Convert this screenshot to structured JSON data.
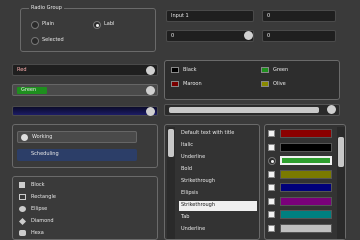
{
  "radio_group": {
    "title": "Radio Group",
    "options": [
      {
        "label": "Plain",
        "selected": false
      },
      {
        "label": "Labl",
        "selected": true
      },
      {
        "label": "Selected",
        "selected": false
      }
    ]
  },
  "inputs": {
    "text_value": "Input 1",
    "slider_value": "0",
    "top_right_value": "0",
    "mid_right_value": "0"
  },
  "labels": {
    "red_label": "Red",
    "green_label": "Green"
  },
  "colors": {
    "swatch_items": [
      {
        "label": "Black",
        "color": "#000000"
      },
      {
        "label": "Green",
        "color": "#1e8f1e"
      },
      {
        "label": "Maroon",
        "color": "#7a0000"
      },
      {
        "label": "Olive",
        "color": "#8a8a00"
      }
    ]
  },
  "toggle_list": {
    "items": [
      "Working",
      "Scheduling"
    ]
  },
  "shapes_list": {
    "items": [
      "Block",
      "Rectangle",
      "Ellipse",
      "Diamond",
      "Hexa"
    ]
  },
  "text_list": {
    "items": [
      "Default text with title",
      "Italic",
      "Underline",
      "Bold",
      "Strikethrough",
      "Ellipsis",
      "Strikethrough",
      "Tab",
      "Underline"
    ],
    "selected_index": 6
  },
  "color_list": {
    "items": [
      {
        "color": "#8b0000",
        "checked": false
      },
      {
        "color": "#000000",
        "checked": false
      },
      {
        "color": "#2e9e2e",
        "checked": true,
        "radio": true
      },
      {
        "color": "#7a7a00",
        "checked": false
      },
      {
        "color": "#00007a",
        "checked": false
      },
      {
        "color": "#7a007a",
        "checked": false
      },
      {
        "color": "#008080",
        "checked": false
      },
      {
        "color": "#c0c0c0",
        "checked": false
      }
    ]
  }
}
